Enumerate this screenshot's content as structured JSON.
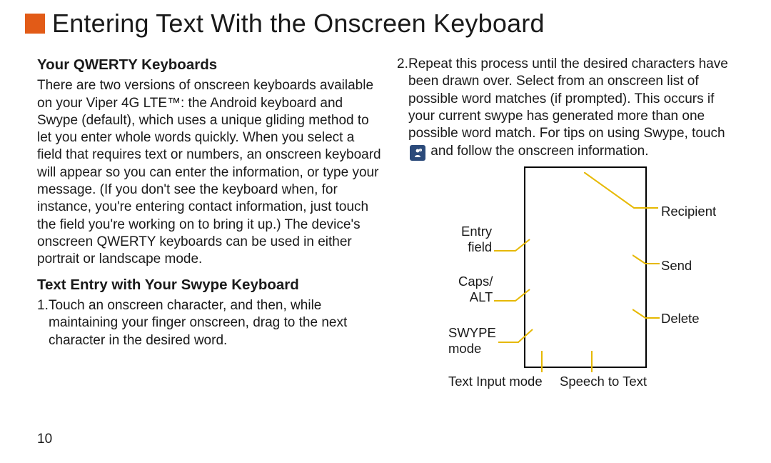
{
  "header": {
    "title": "Entering Text With the Onscreen Keyboard"
  },
  "left": {
    "h1": "Your QWERTY Keyboards",
    "p1": "There are two versions of onscreen keyboards available on your Viper 4G LTE™: the Android keyboard and Swype (default), which uses a unique gliding method to let you enter whole words quickly. When you select a field that requires text or numbers, an onscreen keyboard will appear so you can enter the information, or type your message. (If you don't see the keyboard when, for instance, you're entering contact information, just touch the field you're working on to bring it up.) The device's onscreen QWERTY keyboards can be used in either portrait or landscape mode.",
    "h2": "Text Entry with Your Swype Keyboard",
    "li1_num": "1.",
    "li1": "Touch an onscreen character, and then, while maintaining your finger onscreen, drag to the next character in the desired word."
  },
  "right": {
    "li2_num": "2.",
    "li2a": "Repeat this process until the desired characters have been drawn over. Select from an onscreen list of possible word matches (if prompted). This occurs if your current swype has generated more than one possible word match. For tips on using Swype, touch ",
    "li2b": " and follow the onscreen information."
  },
  "diagram": {
    "entry_field": "Entry\nfield",
    "caps_alt": "Caps/\nALT",
    "swype_mode": "SWYPE\nmode",
    "text_input_mode": "Text Input mode",
    "speech_to_text": "Speech to Text",
    "recipient": "Recipient",
    "send": "Send",
    "delete": "Delete"
  },
  "page_number": "10"
}
